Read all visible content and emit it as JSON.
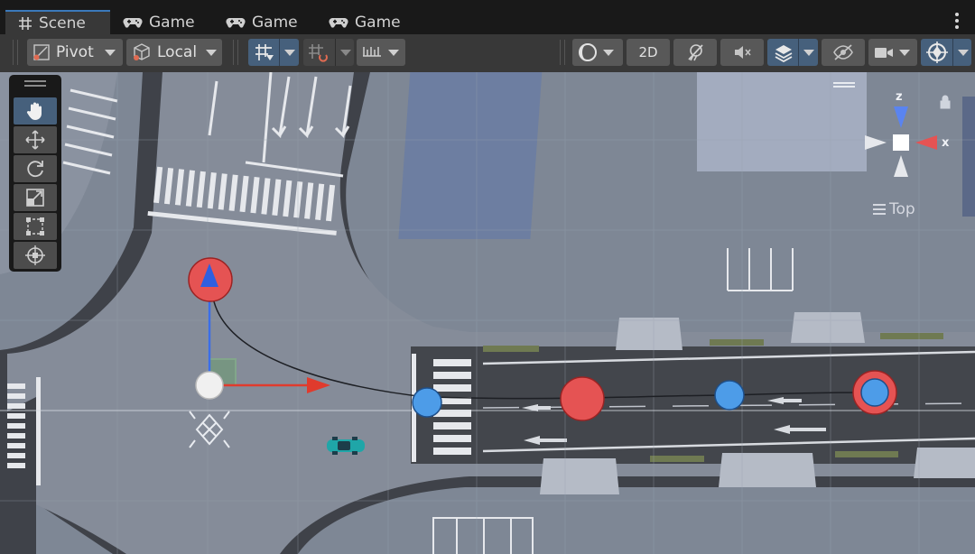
{
  "tabs": [
    {
      "label": "Scene",
      "icon": "hash-icon"
    },
    {
      "label": "Game",
      "icon": "gamepad-icon"
    },
    {
      "label": "Game",
      "icon": "gamepad-icon"
    },
    {
      "label": "Game",
      "icon": "gamepad-icon"
    }
  ],
  "toolbar": {
    "pivot_label": "Pivot",
    "local_label": "Local",
    "two_d_label": "2D",
    "icons": [
      "pivot-icon",
      "local-cube-icon",
      "grid-snap-icon",
      "increment-snap-icon",
      "ruler-icon",
      "shading-sphere-icon",
      "lighting-icon",
      "audio-mute-icon",
      "effects-icon",
      "visibility-icon",
      "camera-icon",
      "gizmos-icon"
    ]
  },
  "tools": [
    "hand-tool-icon",
    "move-tool-icon",
    "rotate-tool-icon",
    "scale-tool-icon",
    "rect-tool-icon",
    "transform-tool-icon"
  ],
  "gizmo": {
    "axis_z": "z",
    "axis_x": "x",
    "view_label": "Top"
  },
  "colors": {
    "accent_blue": "#3a79bb",
    "toolbar_bg": "#383838",
    "tab_bg": "#191919",
    "scene_ground": "#7e8795",
    "road": "#3f4249",
    "waypoint_red": "#e55353",
    "waypoint_blue": "#4d9ce8"
  }
}
